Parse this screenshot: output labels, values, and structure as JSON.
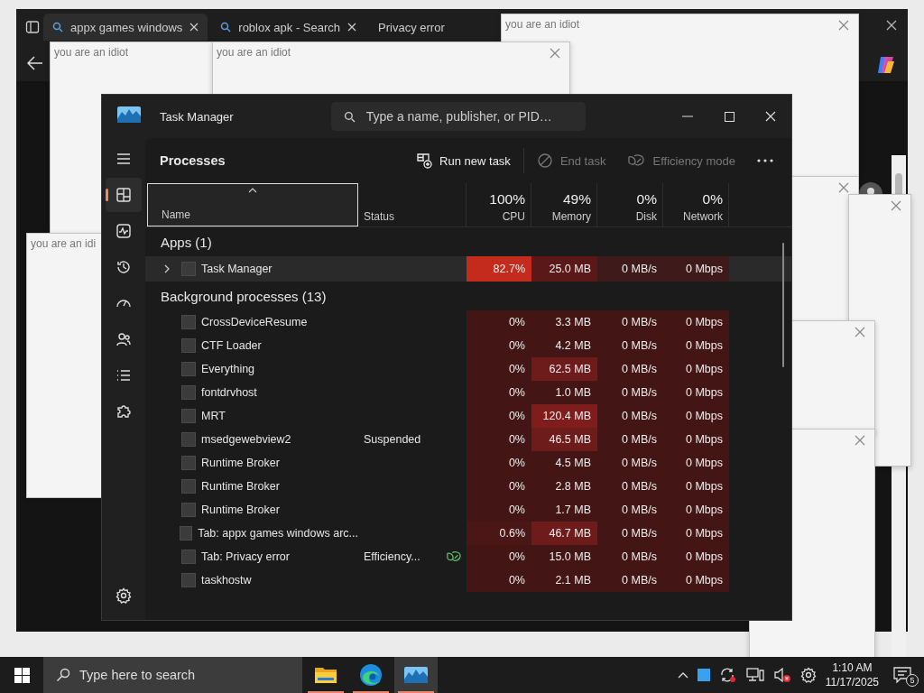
{
  "browser": {
    "tabs": [
      {
        "title": "appx games windows",
        "selected": true
      },
      {
        "title": "roblox apk - Search",
        "selected": false
      },
      {
        "title": "Privacy error",
        "selected": false
      }
    ]
  },
  "popups": [
    {
      "title": "you are an idiot"
    },
    {
      "title": "you are an idiot"
    },
    {
      "title": "you are an idiot"
    },
    {
      "title": "you are an idi"
    }
  ],
  "task_manager": {
    "title": "Task Manager",
    "search": {
      "placeholder": "Type a name, publisher, or PID…"
    },
    "nav": [
      {
        "kind": "menu",
        "selected": false
      },
      {
        "kind": "processes",
        "selected": true
      },
      {
        "kind": "performance",
        "selected": false
      },
      {
        "kind": "history",
        "selected": false
      },
      {
        "kind": "startup",
        "selected": false
      },
      {
        "kind": "users",
        "selected": false
      },
      {
        "kind": "details",
        "selected": false
      },
      {
        "kind": "services",
        "selected": false
      },
      {
        "kind": "settings",
        "selected": false
      }
    ],
    "page_title": "Processes",
    "toolbar": [
      {
        "kind": "run",
        "label": "Run new task",
        "disabled": false
      },
      {
        "kind": "end",
        "label": "End task",
        "disabled": true
      },
      {
        "kind": "efficiency",
        "label": "Efficiency mode",
        "disabled": true
      }
    ],
    "columns": [
      {
        "label": "Name",
        "sorted": true
      },
      {
        "label": "Status",
        "sorted": false
      },
      {
        "usage": "100%",
        "label": "CPU",
        "sorted": false
      },
      {
        "usage": "49%",
        "label": "Memory",
        "sorted": false
      },
      {
        "usage": "0%",
        "label": "Disk",
        "sorted": false
      },
      {
        "usage": "0%",
        "label": "Network",
        "sorted": false
      }
    ],
    "groups": [
      {
        "title": "Apps (1)",
        "rows": [
          {
            "name": "Task Manager",
            "expanded": false,
            "hover": true,
            "cells": [
              {
                "value": "82.7%",
                "color": "#c42b1c"
              },
              {
                "value": "25.0 MB",
                "color": "#5a1818"
              },
              {
                "value": "0 MB/s",
                "color": "#3f1a1a"
              },
              {
                "value": "0 Mbps",
                "color": "#3f1a1a"
              }
            ]
          }
        ]
      },
      {
        "title": "Background processes (13)",
        "rows": [
          {
            "name": "CrossDeviceResume",
            "cells": [
              {
                "value": "0%",
                "color": "#431515"
              },
              {
                "value": "3.3 MB",
                "color": "#431515"
              },
              {
                "value": "0 MB/s",
                "color": "#431515"
              },
              {
                "value": "0 Mbps",
                "color": "#431515"
              }
            ]
          },
          {
            "name": "CTF Loader",
            "cells": [
              {
                "value": "0%",
                "color": "#431515"
              },
              {
                "value": "4.2 MB",
                "color": "#431515"
              },
              {
                "value": "0 MB/s",
                "color": "#431515"
              },
              {
                "value": "0 Mbps",
                "color": "#431515"
              }
            ]
          },
          {
            "name": "Everything",
            "cells": [
              {
                "value": "0%",
                "color": "#431515"
              },
              {
                "value": "62.5 MB",
                "color": "#6e1b1b"
              },
              {
                "value": "0 MB/s",
                "color": "#431515"
              },
              {
                "value": "0 Mbps",
                "color": "#431515"
              }
            ]
          },
          {
            "name": "fontdrvhost",
            "cells": [
              {
                "value": "0%",
                "color": "#431515"
              },
              {
                "value": "1.0 MB",
                "color": "#431515"
              },
              {
                "value": "0 MB/s",
                "color": "#431515"
              },
              {
                "value": "0 Mbps",
                "color": "#431515"
              }
            ]
          },
          {
            "name": "MRT",
            "cells": [
              {
                "value": "0%",
                "color": "#431515"
              },
              {
                "value": "120.4 MB",
                "color": "#7f1d1d"
              },
              {
                "value": "0 MB/s",
                "color": "#431515"
              },
              {
                "value": "0 Mbps",
                "color": "#431515"
              }
            ]
          },
          {
            "name": "msedgewebview2",
            "status": "Suspended",
            "cells": [
              {
                "value": "0%",
                "color": "#431515"
              },
              {
                "value": "46.5 MB",
                "color": "#6e1b1b"
              },
              {
                "value": "0 MB/s",
                "color": "#431515"
              },
              {
                "value": "0 Mbps",
                "color": "#431515"
              }
            ]
          },
          {
            "name": "Runtime Broker",
            "cells": [
              {
                "value": "0%",
                "color": "#431515"
              },
              {
                "value": "4.5 MB",
                "color": "#431515"
              },
              {
                "value": "0 MB/s",
                "color": "#431515"
              },
              {
                "value": "0 Mbps",
                "color": "#431515"
              }
            ]
          },
          {
            "name": "Runtime Broker",
            "cells": [
              {
                "value": "0%",
                "color": "#431515"
              },
              {
                "value": "2.8 MB",
                "color": "#431515"
              },
              {
                "value": "0 MB/s",
                "color": "#431515"
              },
              {
                "value": "0 Mbps",
                "color": "#431515"
              }
            ]
          },
          {
            "name": "Runtime Broker",
            "cells": [
              {
                "value": "0%",
                "color": "#431515"
              },
              {
                "value": "1.7 MB",
                "color": "#431515"
              },
              {
                "value": "0 MB/s",
                "color": "#431515"
              },
              {
                "value": "0 Mbps",
                "color": "#431515"
              }
            ]
          },
          {
            "name": "Tab: appx games windows arc...",
            "cells": [
              {
                "value": "0.6%",
                "color": "#4a1616"
              },
              {
                "value": "46.7 MB",
                "color": "#6e1b1b"
              },
              {
                "value": "0 MB/s",
                "color": "#431515"
              },
              {
                "value": "0 Mbps",
                "color": "#431515"
              }
            ]
          },
          {
            "name": "Tab: Privacy error",
            "status": "Efficiency...",
            "efficiency": true,
            "cells": [
              {
                "value": "0%",
                "color": "#431515"
              },
              {
                "value": "15.0 MB",
                "color": "#431515"
              },
              {
                "value": "0 MB/s",
                "color": "#431515"
              },
              {
                "value": "0 Mbps",
                "color": "#431515"
              }
            ]
          },
          {
            "name": "taskhostw",
            "cells": [
              {
                "value": "0%",
                "color": "#431515"
              },
              {
                "value": "2.1 MB",
                "color": "#431515"
              },
              {
                "value": "0 MB/s",
                "color": "#431515"
              },
              {
                "value": "0 Mbps",
                "color": "#431515"
              }
            ]
          }
        ]
      }
    ]
  },
  "taskbar": {
    "search": {
      "placeholder": "Type here to search"
    },
    "apps": [
      {
        "kind": "explorer",
        "selected": false
      },
      {
        "kind": "edge",
        "selected": false
      },
      {
        "kind": "taskmanager",
        "selected": true
      }
    ],
    "time": "1:10 AM",
    "date": "11/17/2025",
    "notifications": "5"
  }
}
